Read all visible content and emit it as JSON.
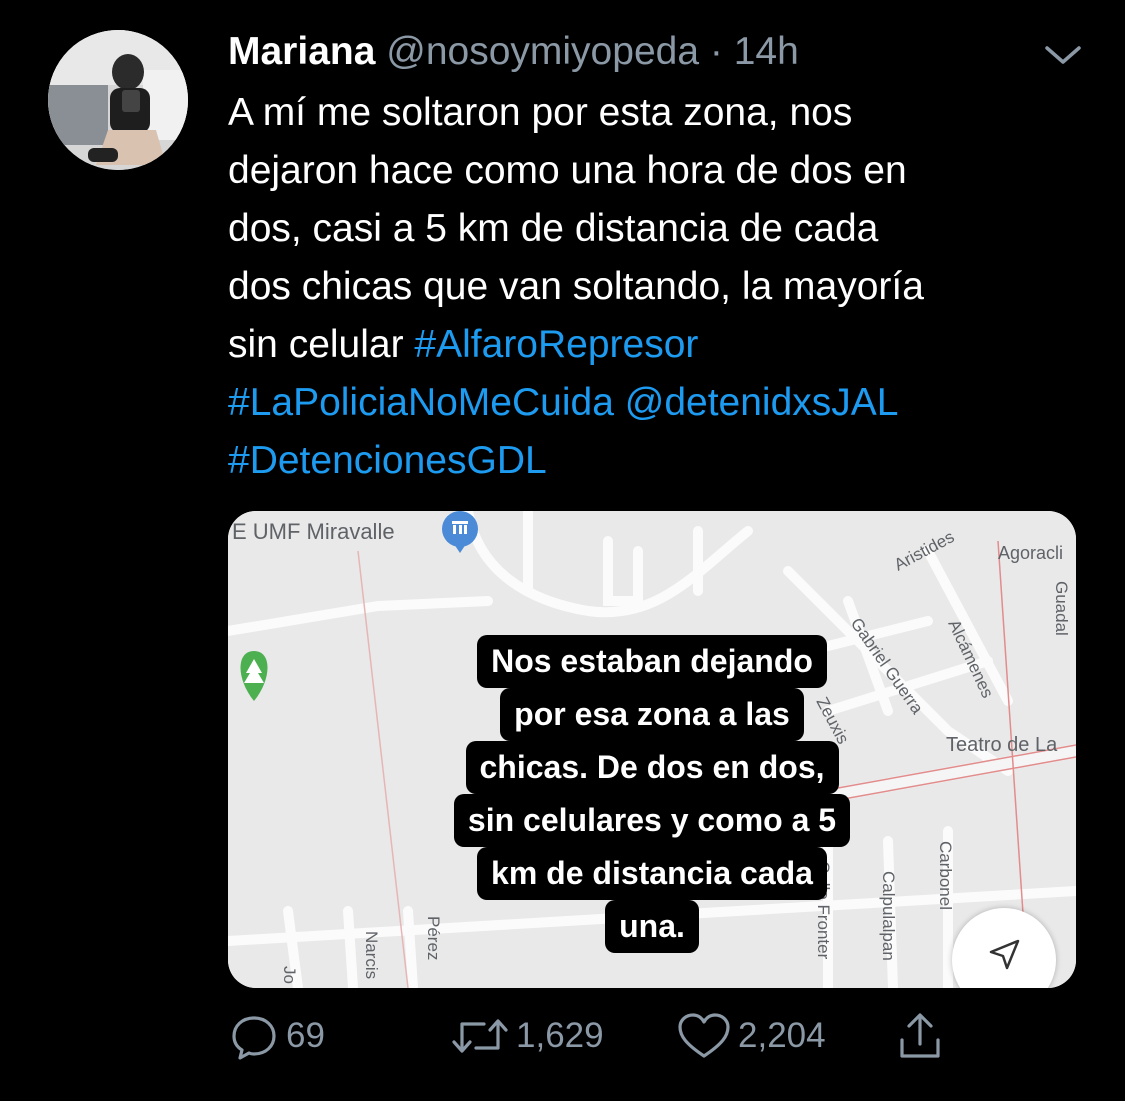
{
  "tweet": {
    "author_name": "Mariana",
    "author_handle": "@nosoymiyopeda",
    "separator": "·",
    "time": "14h",
    "text_lines": [
      "A mí me soltaron por esta zona, nos",
      "dejaron hace como una hora de dos en",
      "dos, casi a 5 km de distancia de cada",
      "dos chicas que van soltando, la mayoría",
      "sin celular "
    ],
    "hashtag_1": "#AlfaroRepresor",
    "hashtag_2": "#LaPoliciaNoMeCuida",
    "mention": "@detenidxsJAL",
    "hashtag_3": "#DetencionesGDL"
  },
  "media": {
    "map_labels": {
      "poi": "E UMF Miravalle",
      "aristides": "Aristides",
      "agoracli": "Agoracli",
      "guadal": "Guadal",
      "gabriel_guerra": "Gabriel Guerra",
      "alcamenes": "Alcámenes",
      "zeuxis": "Zeuxis",
      "teatro": "Teatro de La",
      "carbonel": "Carbonel",
      "calle_frontera": "Calle Fronter",
      "calpulalpan": "Calpulalpan",
      "perez": "Pérez",
      "narcis": "Narcis",
      "jo": "Jo"
    },
    "caption_lines": [
      "Nos estaban dejando",
      "por esa zona a las",
      "chicas. De dos en dos,",
      "sin celulares y como a 5",
      "km de distancia cada",
      "una."
    ]
  },
  "actions": {
    "replies": "69",
    "retweets": "1,629",
    "likes": "2,204"
  },
  "colors": {
    "background": "#000000",
    "link": "#1d9bf0",
    "secondary_text": "#8b98a5",
    "map_background": "#e9e9e9"
  }
}
